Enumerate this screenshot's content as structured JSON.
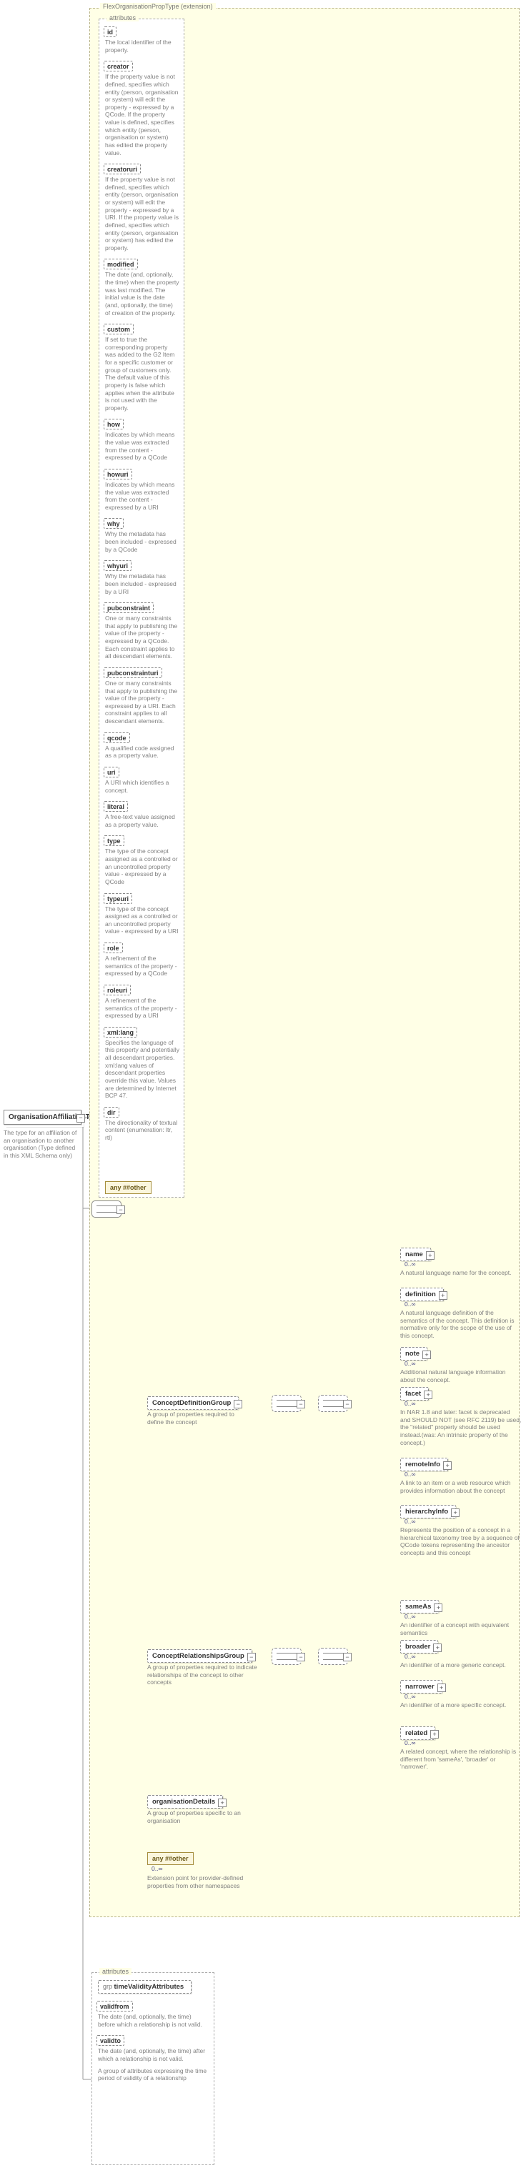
{
  "root": {
    "title": "OrganisationAffiliationType",
    "desc": "The type for an affiliation of an organisation to another organisation (Type defined in this XML Schema only)"
  },
  "ext_label": "FlexOrganisationPropType (extension)",
  "attr_panel_label": "attributes",
  "attrs": [
    {
      "name": "id",
      "desc": "The local identifier of the property."
    },
    {
      "name": "creator",
      "desc": "If the property value is not defined, specifies which entity (person, organisation or system) will edit the property - expressed by a QCode. If the property value is defined, specifies which entity (person, organisation or system) has edited the property value."
    },
    {
      "name": "creatoruri",
      "desc": "If the property value is not defined, specifies which entity (person, organisation or system) will edit the property - expressed by a URI. If the property value is defined, specifies which entity (person, organisation or system) has edited the property."
    },
    {
      "name": "modified",
      "desc": "The date (and, optionally, the time) when the property was last modified. The initial value is the date (and, optionally, the time) of creation of the property."
    },
    {
      "name": "custom",
      "desc": "If set to true the corresponding property was added to the G2 Item for a specific customer or group of customers only. The default value of this property is false which applies when the attribute is not used with the property."
    },
    {
      "name": "how",
      "desc": "Indicates by which means the value was extracted from the content - expressed by a QCode"
    },
    {
      "name": "howuri",
      "desc": "Indicates by which means the value was extracted from the content - expressed by a URI"
    },
    {
      "name": "why",
      "desc": "Why the metadata has been included - expressed by a QCode"
    },
    {
      "name": "whyuri",
      "desc": "Why the metadata has been included - expressed by a URI"
    },
    {
      "name": "pubconstraint",
      "desc": "One or many constraints that apply to publishing the value of the property - expressed by a QCode. Each constraint applies to all descendant elements."
    },
    {
      "name": "pubconstrainturi",
      "desc": "One or many constraints that apply to publishing the value of the property - expressed by a URI. Each constraint applies to all descendant elements."
    },
    {
      "name": "qcode",
      "desc": "A qualified code assigned as a property value."
    },
    {
      "name": "uri",
      "desc": "A URI which identifies a concept."
    },
    {
      "name": "literal",
      "desc": "A free-text value assigned as a property value."
    },
    {
      "name": "type",
      "desc": "The type of the concept assigned as a controlled or an uncontrolled property value - expressed by a QCode"
    },
    {
      "name": "typeuri",
      "desc": "The type of the concept assigned as a controlled or an uncontrolled property value - expressed by a URI"
    },
    {
      "name": "role",
      "desc": "A refinement of the semantics of the property - expressed by a QCode"
    },
    {
      "name": "roleuri",
      "desc": "A refinement of the semantics of the property - expressed by a URI"
    },
    {
      "name": "xml:lang",
      "desc": "Specifies the language of this property and potentially all descendant properties. xml:lang values of descendant properties override this value. Values are determined by Internet BCP 47."
    },
    {
      "name": "dir",
      "desc": "The directionality of textual content (enumeration: ltr, rtl)"
    }
  ],
  "any_attr": "any ##other",
  "groups": {
    "cd": {
      "label": "ConceptDefinitionGroup",
      "desc": "A group of properties required to define the concept"
    },
    "cr": {
      "label": "ConceptRelationshipsGroup",
      "desc": "A group of properties required to indicate relationships of the concept to other concepts"
    },
    "od": {
      "label": "organisationDetails",
      "desc": "A group of properties specific to an organisation"
    },
    "other": {
      "label": "any ##other",
      "desc": "Extension point for provider-defined properties from other namespaces"
    }
  },
  "leavesCD": [
    {
      "name": "name",
      "desc": "A natural language name for the concept."
    },
    {
      "name": "definition",
      "desc": "A natural language definition of the semantics of the concept. This definition is normative only for the scope of the use of this concept."
    },
    {
      "name": "note",
      "desc": "Additional natural language information about the concept."
    },
    {
      "name": "facet",
      "desc": "In NAR 1.8 and later: facet is deprecated and SHOULD NOT (see RFC 2119) be used, the \"related\" property should be used instead.(was: An intrinsic property of the concept.)"
    },
    {
      "name": "remoteInfo",
      "desc": "A link to an item or a web resource which provides information about the concept"
    },
    {
      "name": "hierarchyInfo",
      "desc": "Represents the position of a concept in a hierarchical taxonomy tree by a sequence of QCode tokens representing the ancestor concepts and this concept"
    }
  ],
  "leavesCR": [
    {
      "name": "sameAs",
      "desc": "An identifier of a concept with equivalent semantics"
    },
    {
      "name": "broader",
      "desc": "An identifier of a more generic concept."
    },
    {
      "name": "narrower",
      "desc": "An identifier of a more specific concept."
    },
    {
      "name": "related",
      "desc": "A related concept, where the relationship is different from 'sameAs', 'broader' or 'narrower'."
    }
  ],
  "time_panel": {
    "group": "timeValidityAttributes",
    "items": [
      {
        "name": "validfrom",
        "desc": "The date (and, optionally, the time) before which a relationship is not valid."
      },
      {
        "name": "validto",
        "desc": "The date (and, optionally, the time) after which a relationship is not valid."
      }
    ],
    "foot": "A group of attributes expressing the time period of validity of a relationship"
  },
  "card": {
    "zero_inf": "0..∞"
  }
}
